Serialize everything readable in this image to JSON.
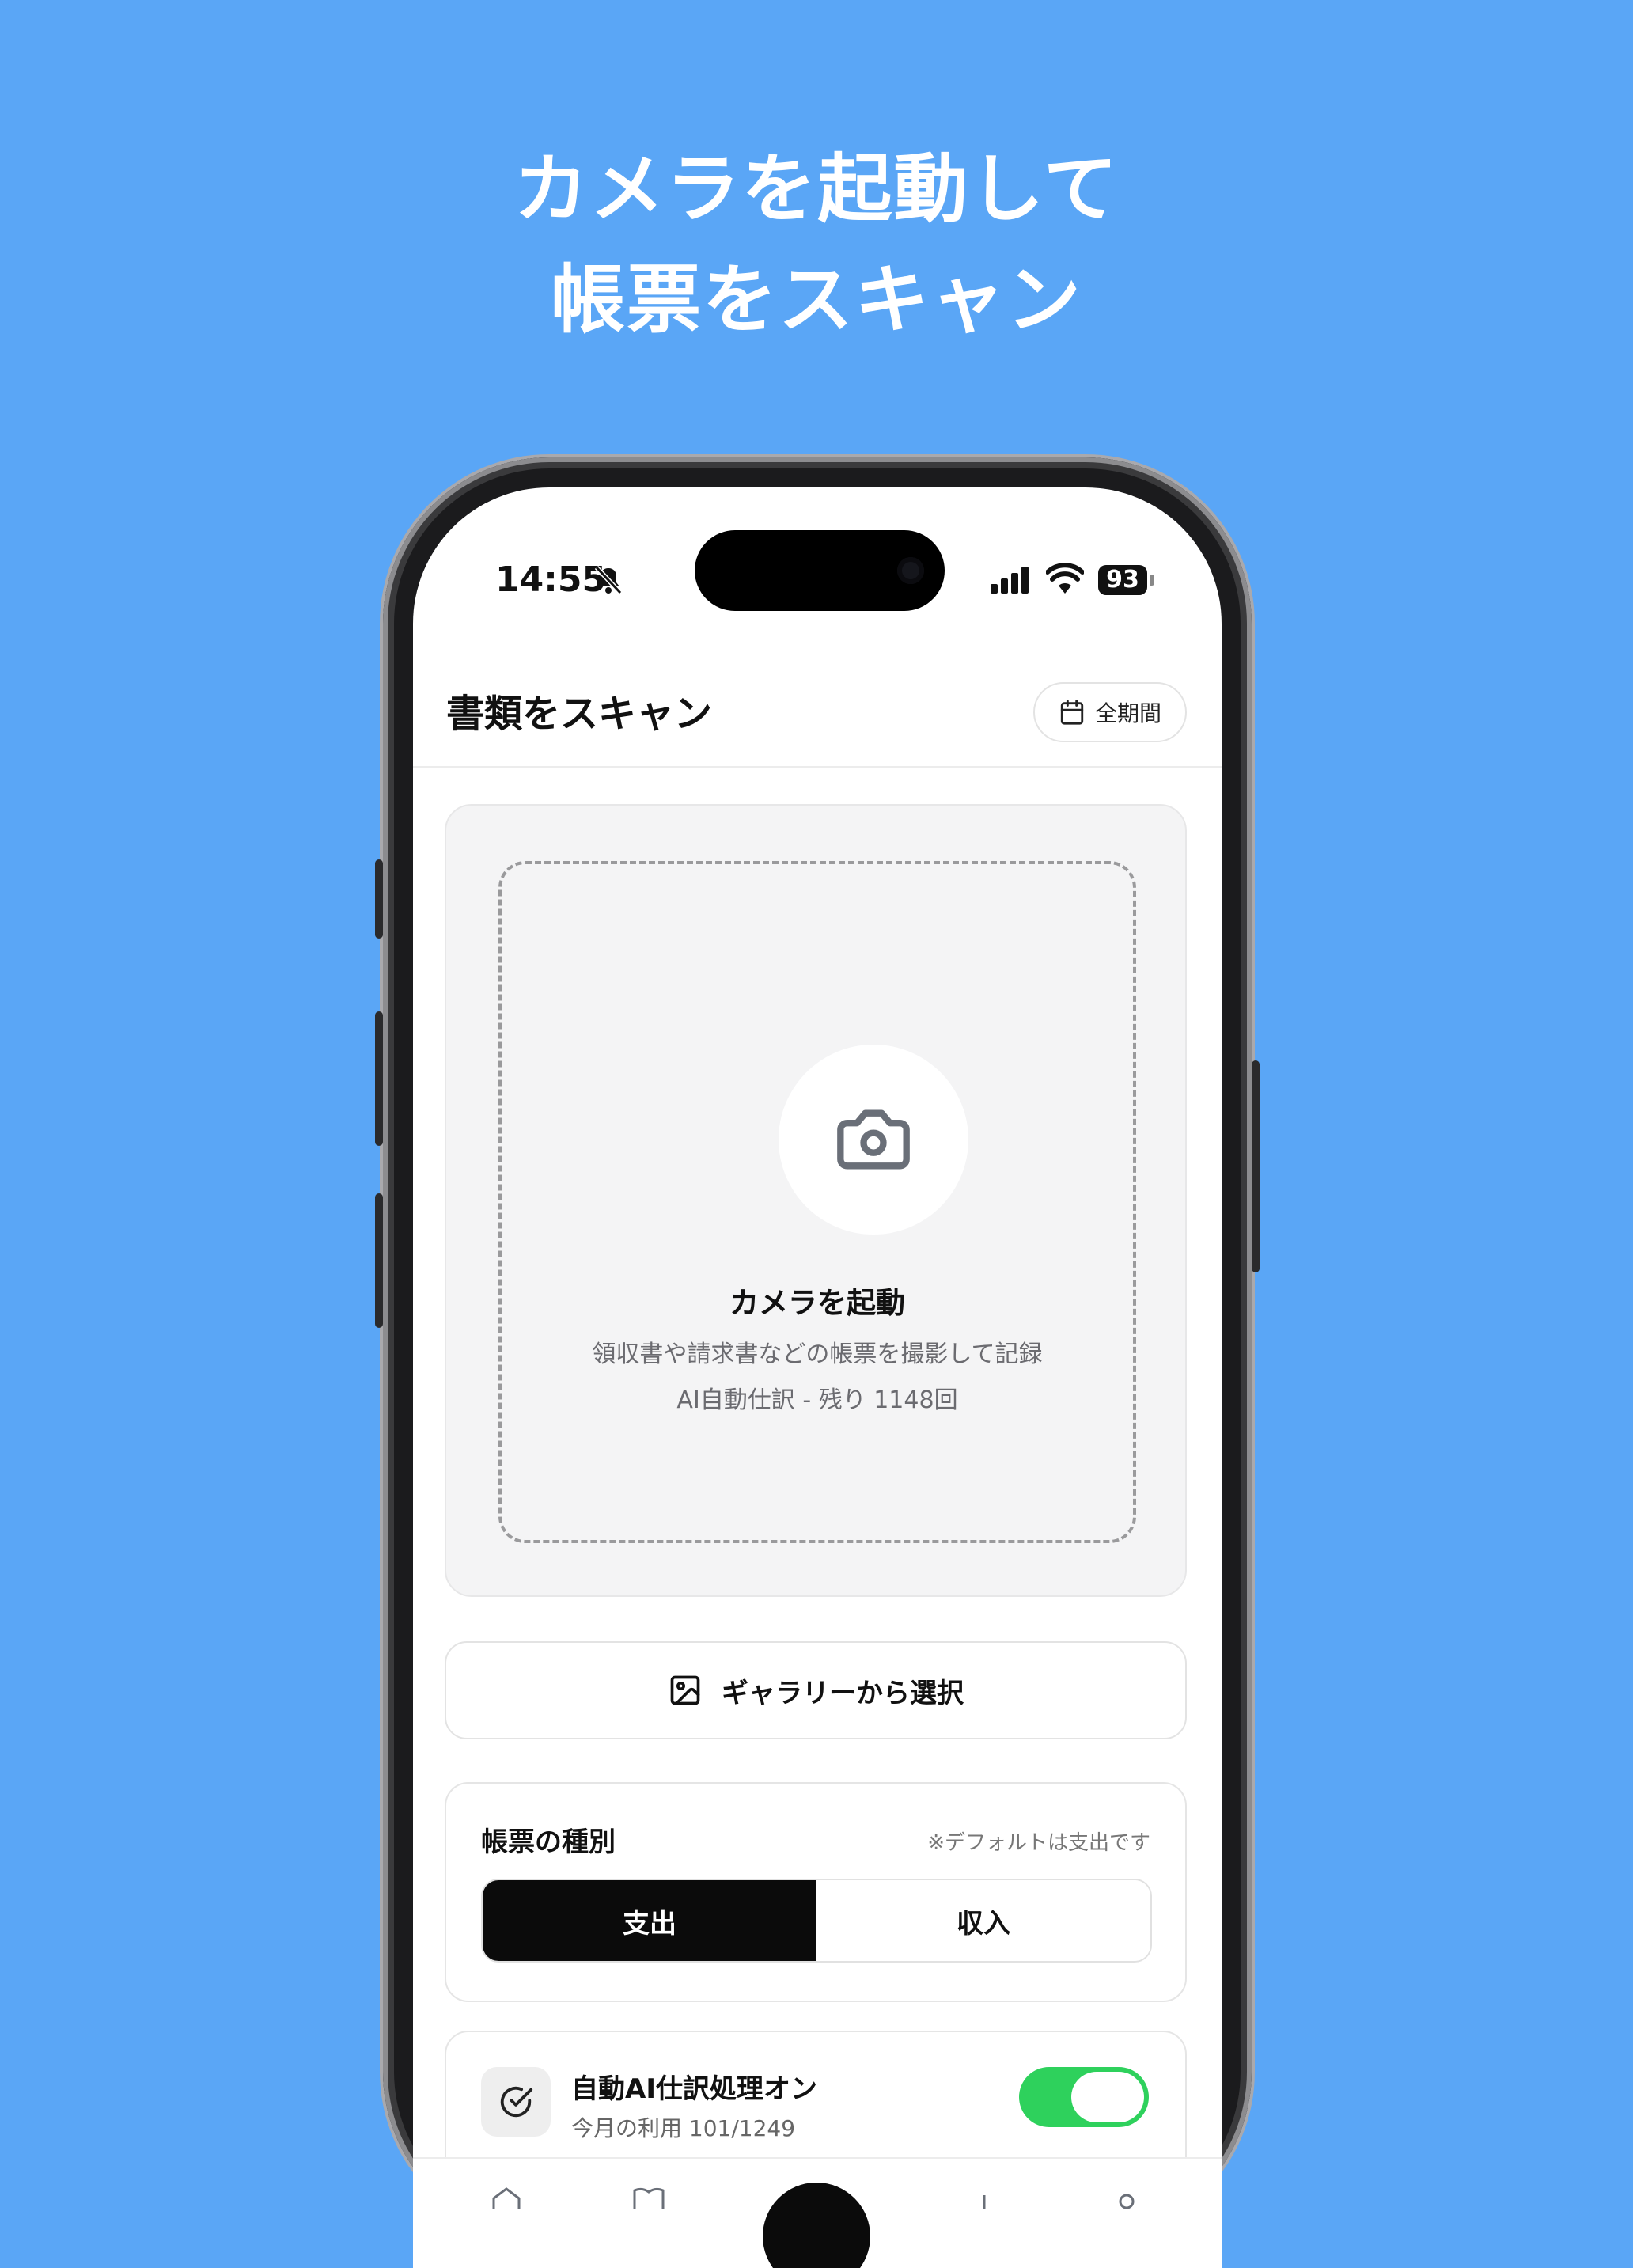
{
  "headline": {
    "line1": "カメラを起動して",
    "line2": "帳票をスキャン"
  },
  "status_bar": {
    "time": "14:55",
    "battery": "93"
  },
  "header": {
    "title": "書類をスキャン",
    "period_button": "全期間"
  },
  "scan_area": {
    "title": "カメラを起動",
    "description": "領収書や請求書などの帳票を撮影して記録",
    "ai_remaining": "AI自動仕訳 - 残り 1148回"
  },
  "gallery_button": "ギャラリーから選択",
  "document_type": {
    "title": "帳票の種別",
    "note": "※デフォルトは支出です",
    "options": [
      "支出",
      "収入"
    ],
    "selected": "支出"
  },
  "auto_ai": {
    "title": "自動AI仕訳処理オン",
    "usage": "今月の利用 101/1249",
    "enabled": true
  },
  "colors": {
    "background": "#5AA6F6",
    "toggle_on": "#2ED15C",
    "segment_active": "#0B0B0B"
  }
}
